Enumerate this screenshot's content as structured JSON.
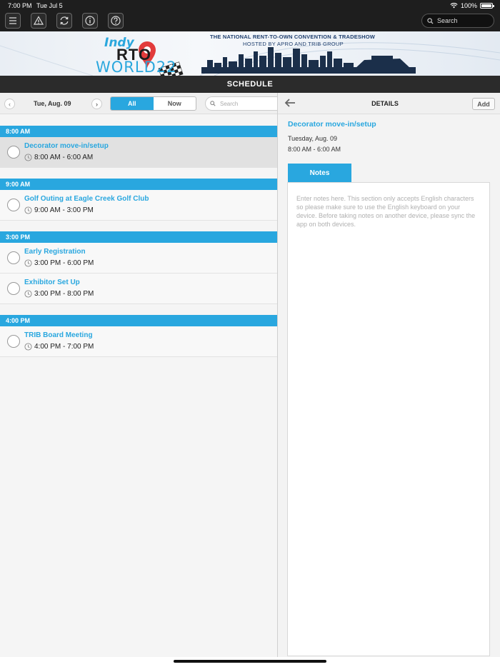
{
  "status_bar": {
    "time": "7:00 PM",
    "date": "Tue Jul 5",
    "battery": "100%"
  },
  "toolbar": {
    "icons": [
      "menu-icon",
      "alert-icon",
      "sync-icon",
      "info-icon",
      "help-icon"
    ],
    "search_placeholder": "Search"
  },
  "banner": {
    "logo_small": "Indy",
    "logo_main": "RTO",
    "logo_world": "WORLD22",
    "line1": "THE NATIONAL RENT-TO-OWN CONVENTION & TRADESHOW",
    "line2": "HOSTED BY APRO AND TRIB GROUP"
  },
  "page_title": "SCHEDULE",
  "schedule": {
    "date": "Tue, Aug. 09",
    "filter_all": "All",
    "filter_now": "Now",
    "search_placeholder": "Search",
    "sections": [
      {
        "header": "8:00 AM",
        "events": [
          {
            "name": "Decorator move-in/setup",
            "time": "8:00 AM - 6:00 AM",
            "selected": true
          }
        ]
      },
      {
        "header": "9:00 AM",
        "events": [
          {
            "name": "Golf Outing at Eagle Creek Golf Club",
            "time": "9:00 AM - 3:00 PM"
          }
        ]
      },
      {
        "header": "3:00 PM",
        "events": [
          {
            "name": "Early Registration",
            "time": "3:00 PM - 6:00 PM"
          },
          {
            "name": "Exhibitor Set Up",
            "time": "3:00 PM - 8:00 PM"
          }
        ]
      },
      {
        "header": "4:00 PM",
        "events": [
          {
            "name": "TRIB Board Meeting",
            "time": "4:00 PM - 7:00 PM"
          }
        ]
      }
    ]
  },
  "details": {
    "title": "DETAILS",
    "add_label": "Add",
    "event_name": "Decorator move-in/setup",
    "event_date": "Tuesday, Aug. 09",
    "event_time": "8:00 AM - 6:00 AM",
    "notes_tab": "Notes",
    "notes_placeholder": "Enter notes here. This section only accepts English characters so please make sure to use the English keyboard on your device. Before taking notes on another device, please sync the app on both devices."
  },
  "colors": {
    "accent": "#29a7df",
    "toolbar": "#1e1e1e",
    "titlebar": "#2b2b2b"
  }
}
